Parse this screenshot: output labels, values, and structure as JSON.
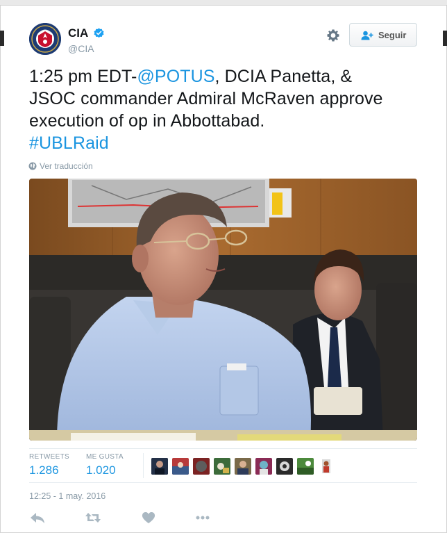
{
  "user": {
    "name": "CIA",
    "handle": "@CIA",
    "verified": true,
    "avatar_icon": "cia-seal-icon"
  },
  "header": {
    "settings_icon": "gear-icon",
    "follow_label": "Seguir"
  },
  "tweet": {
    "line1_prefix": "1:25 pm EDT-",
    "line1_mention": "@POTUS",
    "line1_suffix": ", DCIA Panetta, &",
    "line2": "JSOC commander Admiral McRaven approve",
    "line3": "execution of op in Abbottabad.",
    "hashtag": "#UBLRaid",
    "translate_label": "Ver traducción"
  },
  "stats": {
    "retweets_label": "RETWEETS",
    "retweets_value": "1.286",
    "likes_label": "ME GUSTA",
    "likes_value": "1.020",
    "liker_count": 9
  },
  "timestamp": "12:25 - 1 may. 2016",
  "actions": [
    "reply-icon",
    "retweet-icon",
    "like-icon",
    "more-icon"
  ],
  "colors": {
    "link": "#1b95e0",
    "secondary_text": "#8899a6",
    "text": "#14171a"
  }
}
